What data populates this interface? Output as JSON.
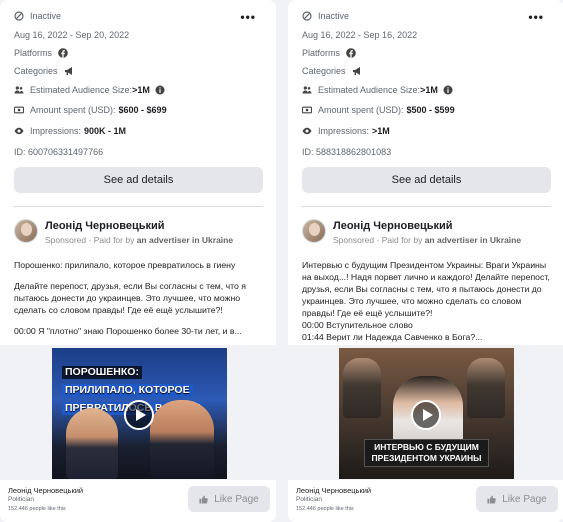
{
  "cards": [
    {
      "status": "Inactive",
      "dates": "Aug 16, 2022 - Sep 20, 2022",
      "platforms_label": "Platforms",
      "categories_label": "Categories",
      "audience_label": "Estimated Audience Size:",
      "audience_value": ">1M",
      "amount_label": "Amount spent (USD):",
      "amount_value": "$600 - $699",
      "impressions_label": "Impressions:",
      "impressions_value": "900K - 1M",
      "id_text": "ID: 600706331497766",
      "details_button": "See ad details",
      "page_name": "Леонід Черновецький",
      "sponsored": "Sponsored",
      "paid_for_prefix": "· Paid for by",
      "advertiser": "an advertiser in Ukraine",
      "body_lines": [
        "Порошенко: прилипало, которое превратилось в гиену",
        "",
        "Делайте перепост, друзья, если Вы согласны с тем, что я пытаюсь донести до украинцев. Это лучшее, что можно сделать со словом правды! Где её ещё услышите?!",
        "",
        "00:00 Я \"плотно\" знаю Порошенко более 30-ти лет, и в..."
      ],
      "video_headline": [
        "ПОРОШЕНКО:",
        "ПРИЛИПАЛО, КОТОРОЕ",
        "ПРЕВРАТИЛОСЬ В ГИЕНУ"
      ],
      "video_caption": [],
      "footer_name": "Леонід Черновецький",
      "footer_role": "Politician",
      "footer_likes": "152,446 people like this",
      "like_button": "Like Page"
    },
    {
      "status": "Inactive",
      "dates": "Aug 16, 2022 - Sep 16, 2022",
      "platforms_label": "Platforms",
      "categories_label": "Categories",
      "audience_label": "Estimated Audience Size:",
      "audience_value": ">1M",
      "amount_label": "Amount spent (USD):",
      "amount_value": "$500 - $599",
      "impressions_label": "Impressions:",
      "impressions_value": ">1M",
      "id_text": "ID: 588318862801083",
      "details_button": "See ad details",
      "page_name": "Леонід Черновецький",
      "sponsored": "Sponsored",
      "paid_for_prefix": "· Paid for by",
      "advertiser": "an advertiser in Ukraine",
      "body_lines": [
        "Интервью с будущим Президентом Украины: Враги Украины на выход...! Надя порвет лично и каждого! Делайте перепост, друзья, если Вы согласны с тем, что я пытаюсь донести до украинцев. Это лучшее, что можно сделать со словом правды! Где её ещё услышите?!",
        "00:00 Вступительное слово",
        "01:44 Верит ли Надежда Савченко в Бога?..."
      ],
      "video_headline": [],
      "video_caption": [
        "ИНТЕРВЬЮ С БУДУЩИМ",
        "ПРЕЗИДЕНТОМ УКРАИНЫ"
      ],
      "footer_name": "Леонід Черновецький",
      "footer_role": "Politician",
      "footer_likes": "152,446 people like this",
      "like_button": "Like Page"
    }
  ],
  "icons": {
    "status": "inactive-status-icon",
    "platforms": "facebook-icon",
    "categories": "megaphone-icon",
    "audience": "people-icon",
    "info": "info-icon",
    "amount": "money-icon",
    "impressions": "eye-icon",
    "more": "more-icon",
    "play": "play-icon",
    "like": "thumbs-up-icon"
  },
  "colors": {
    "background": "#f0f2f5",
    "card": "#ffffff",
    "button": "#e4e6eb",
    "muted_text": "#606770"
  }
}
